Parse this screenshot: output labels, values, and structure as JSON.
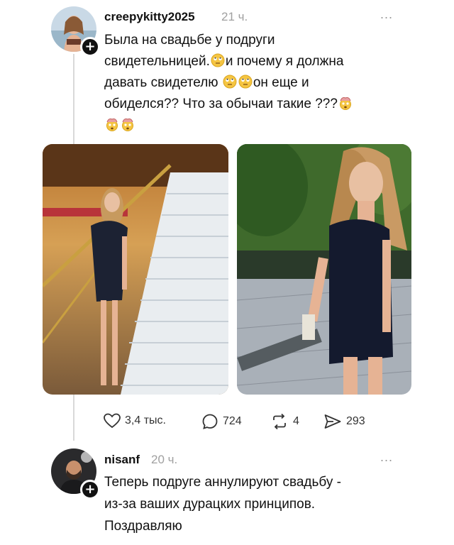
{
  "post": {
    "username": "creepykitty2025",
    "time": "21 ч.",
    "more": "...",
    "text_line1": "Была на свадьбе у подруги",
    "text_line2a": "свидетельницей.",
    "text_line2b": "и почему я должна",
    "text_line3a": "давать свидетелю",
    "text_line3b": "он еще и",
    "text_line4": "обиделся?? Что за обычаи такие ???",
    "follow": "+"
  },
  "actions": {
    "likes": "3,4 тыс.",
    "comments": "724",
    "reposts": "4",
    "shares": "293"
  },
  "reply": {
    "username": "nisanf",
    "time": "20 ч.",
    "more": "...",
    "text_line1": "Теперь подруге аннулируют свадьбу -",
    "text_line2": "из-за ваших дурацких принципов.",
    "text_line3": "Поздравляю",
    "follow": "+"
  },
  "colors": {
    "emoji": "#f5c542",
    "text": "#111111",
    "muted": "#a0a0a0",
    "line": "#d9d9d9"
  },
  "icons": [
    "heart-icon",
    "comment-icon",
    "repost-icon",
    "share-icon",
    "plus-icon",
    "more-icon"
  ]
}
